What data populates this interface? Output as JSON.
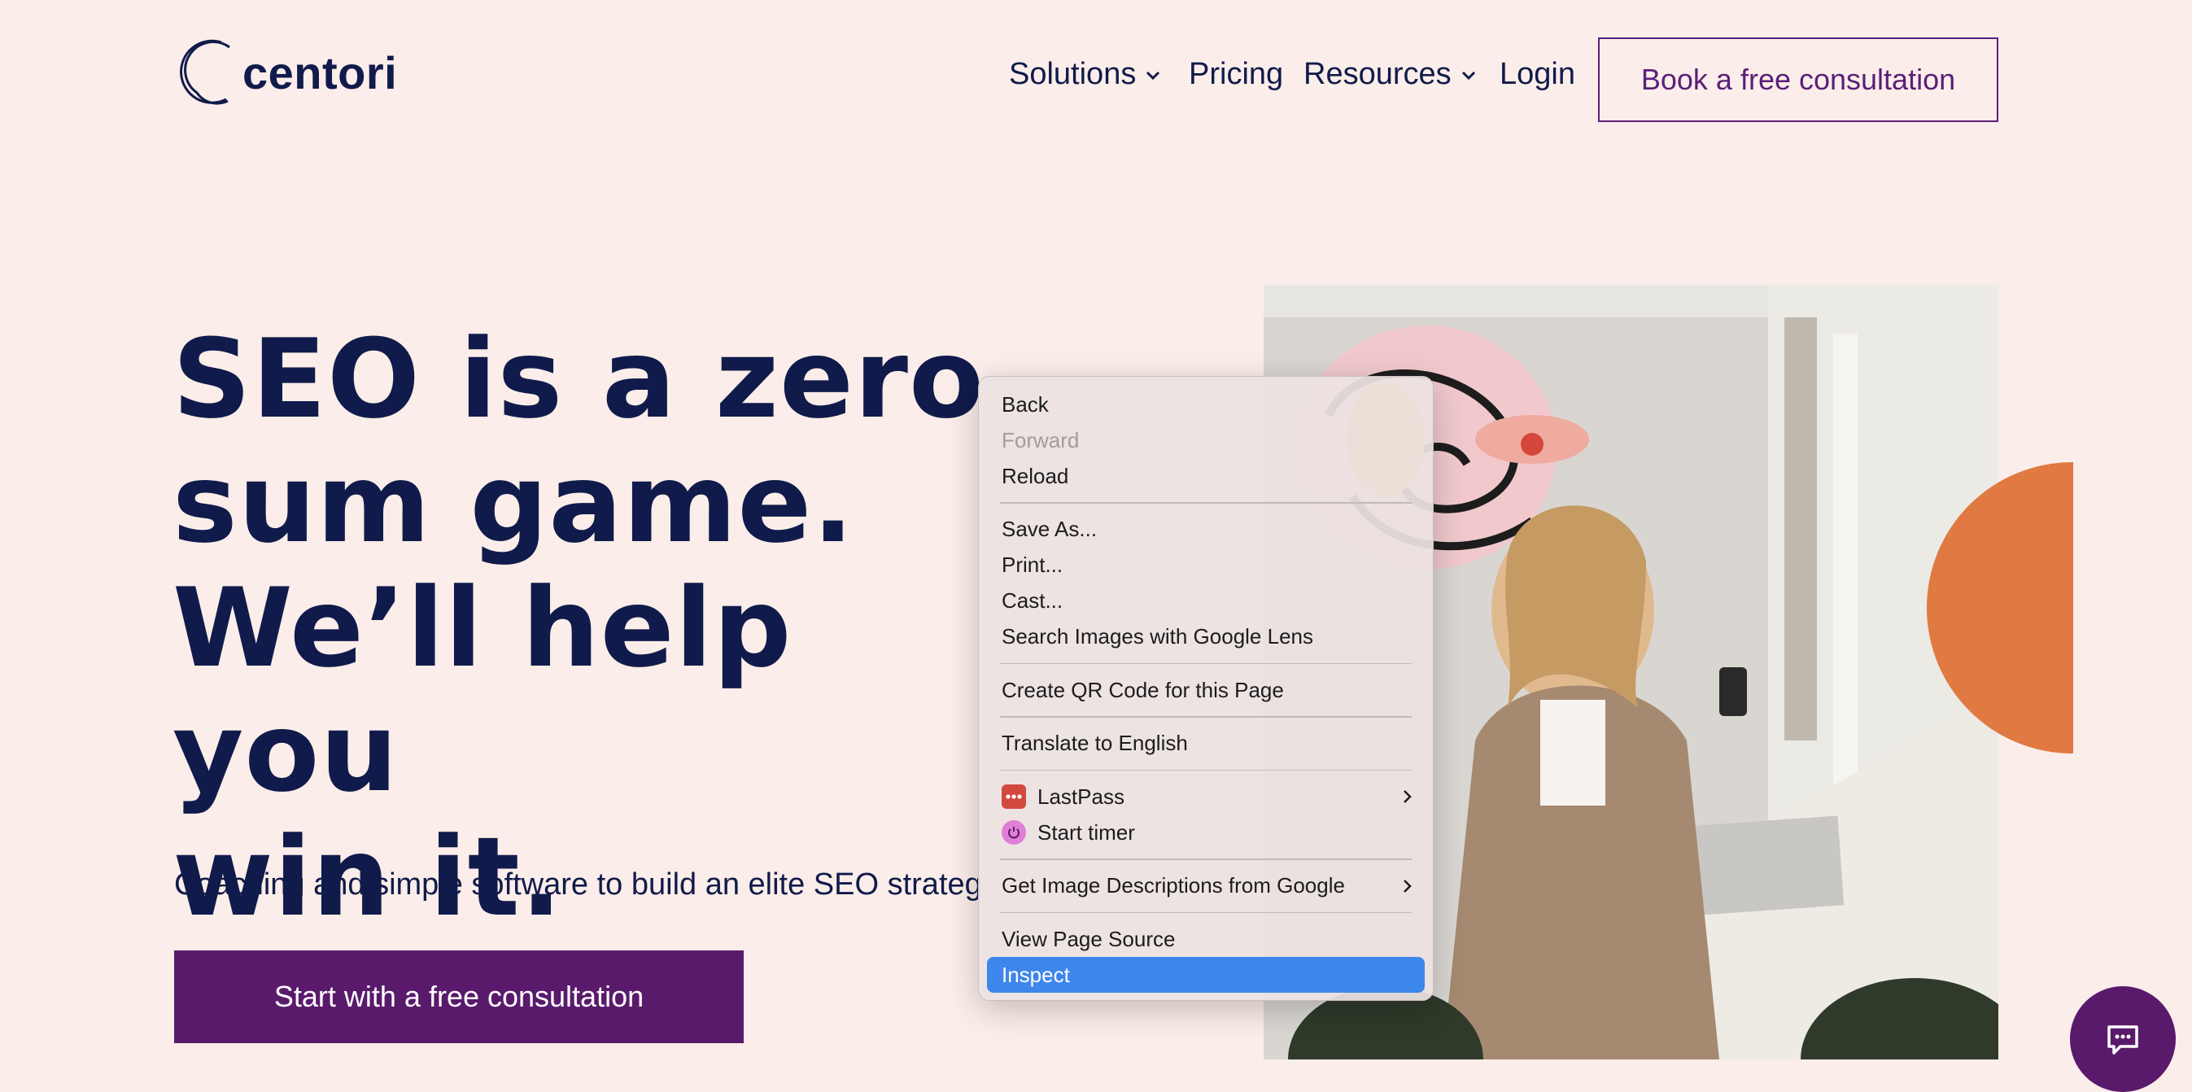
{
  "brand": {
    "name": "centori"
  },
  "nav": {
    "solutions": "Solutions",
    "pricing": "Pricing",
    "resources": "Resources",
    "login": "Login",
    "cta": "Book a free consultation"
  },
  "hero": {
    "title_lines": [
      "SEO is a zero",
      "sum game.",
      "We’ll help you",
      "win it."
    ],
    "subtitle": "Coaching and simple software to build an elite SEO strateg",
    "cta": "Start with a free consultation"
  },
  "context_menu": {
    "back": "Back",
    "forward": "Forward",
    "reload": "Reload",
    "save_as": "Save As...",
    "print": "Print...",
    "cast": "Cast...",
    "search_lens": "Search Images with Google Lens",
    "qr_code": "Create QR Code for this Page",
    "translate": "Translate to English",
    "lastpass": "LastPass",
    "start_timer": "Start timer",
    "image_descriptions": "Get Image Descriptions from Google",
    "view_source": "View Page Source",
    "inspect": "Inspect"
  },
  "colors": {
    "background": "#fbede9",
    "navy": "#101b4b",
    "purple": "#5a1a6c",
    "orange": "#e07a42",
    "menu_highlight": "#3d86ec"
  },
  "icons": {
    "chevron": "chevron-down-icon",
    "submenu": "chevron-right-icon",
    "lastpass": "lastpass-icon",
    "timer": "timer-icon",
    "chat": "chat-icon"
  }
}
